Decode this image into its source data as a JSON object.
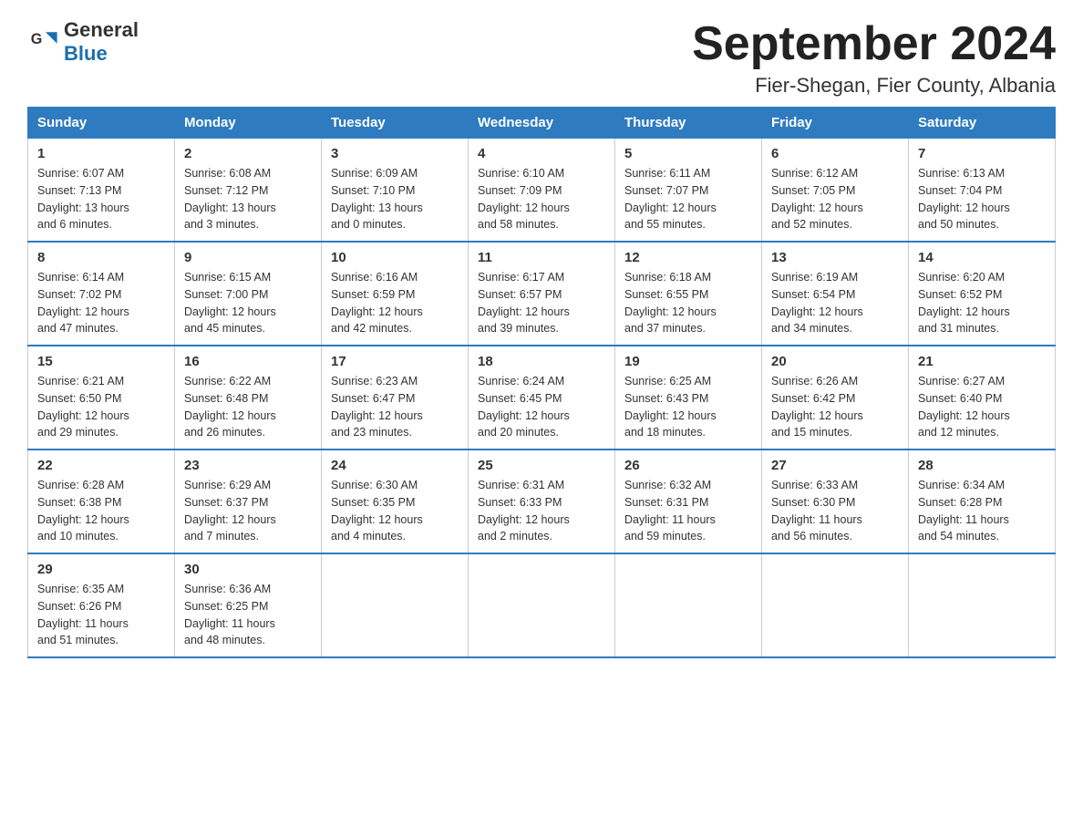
{
  "header": {
    "logo_general": "General",
    "logo_blue": "Blue",
    "month_title": "September 2024",
    "location": "Fier-Shegan, Fier County, Albania"
  },
  "weekdays": [
    "Sunday",
    "Monday",
    "Tuesday",
    "Wednesday",
    "Thursday",
    "Friday",
    "Saturday"
  ],
  "weeks": [
    [
      {
        "day": "1",
        "sunrise": "6:07 AM",
        "sunset": "7:13 PM",
        "daylight": "13 hours and 6 minutes."
      },
      {
        "day": "2",
        "sunrise": "6:08 AM",
        "sunset": "7:12 PM",
        "daylight": "13 hours and 3 minutes."
      },
      {
        "day": "3",
        "sunrise": "6:09 AM",
        "sunset": "7:10 PM",
        "daylight": "13 hours and 0 minutes."
      },
      {
        "day": "4",
        "sunrise": "6:10 AM",
        "sunset": "7:09 PM",
        "daylight": "12 hours and 58 minutes."
      },
      {
        "day": "5",
        "sunrise": "6:11 AM",
        "sunset": "7:07 PM",
        "daylight": "12 hours and 55 minutes."
      },
      {
        "day": "6",
        "sunrise": "6:12 AM",
        "sunset": "7:05 PM",
        "daylight": "12 hours and 52 minutes."
      },
      {
        "day": "7",
        "sunrise": "6:13 AM",
        "sunset": "7:04 PM",
        "daylight": "12 hours and 50 minutes."
      }
    ],
    [
      {
        "day": "8",
        "sunrise": "6:14 AM",
        "sunset": "7:02 PM",
        "daylight": "12 hours and 47 minutes."
      },
      {
        "day": "9",
        "sunrise": "6:15 AM",
        "sunset": "7:00 PM",
        "daylight": "12 hours and 45 minutes."
      },
      {
        "day": "10",
        "sunrise": "6:16 AM",
        "sunset": "6:59 PM",
        "daylight": "12 hours and 42 minutes."
      },
      {
        "day": "11",
        "sunrise": "6:17 AM",
        "sunset": "6:57 PM",
        "daylight": "12 hours and 39 minutes."
      },
      {
        "day": "12",
        "sunrise": "6:18 AM",
        "sunset": "6:55 PM",
        "daylight": "12 hours and 37 minutes."
      },
      {
        "day": "13",
        "sunrise": "6:19 AM",
        "sunset": "6:54 PM",
        "daylight": "12 hours and 34 minutes."
      },
      {
        "day": "14",
        "sunrise": "6:20 AM",
        "sunset": "6:52 PM",
        "daylight": "12 hours and 31 minutes."
      }
    ],
    [
      {
        "day": "15",
        "sunrise": "6:21 AM",
        "sunset": "6:50 PM",
        "daylight": "12 hours and 29 minutes."
      },
      {
        "day": "16",
        "sunrise": "6:22 AM",
        "sunset": "6:48 PM",
        "daylight": "12 hours and 26 minutes."
      },
      {
        "day": "17",
        "sunrise": "6:23 AM",
        "sunset": "6:47 PM",
        "daylight": "12 hours and 23 minutes."
      },
      {
        "day": "18",
        "sunrise": "6:24 AM",
        "sunset": "6:45 PM",
        "daylight": "12 hours and 20 minutes."
      },
      {
        "day": "19",
        "sunrise": "6:25 AM",
        "sunset": "6:43 PM",
        "daylight": "12 hours and 18 minutes."
      },
      {
        "day": "20",
        "sunrise": "6:26 AM",
        "sunset": "6:42 PM",
        "daylight": "12 hours and 15 minutes."
      },
      {
        "day": "21",
        "sunrise": "6:27 AM",
        "sunset": "6:40 PM",
        "daylight": "12 hours and 12 minutes."
      }
    ],
    [
      {
        "day": "22",
        "sunrise": "6:28 AM",
        "sunset": "6:38 PM",
        "daylight": "12 hours and 10 minutes."
      },
      {
        "day": "23",
        "sunrise": "6:29 AM",
        "sunset": "6:37 PM",
        "daylight": "12 hours and 7 minutes."
      },
      {
        "day": "24",
        "sunrise": "6:30 AM",
        "sunset": "6:35 PM",
        "daylight": "12 hours and 4 minutes."
      },
      {
        "day": "25",
        "sunrise": "6:31 AM",
        "sunset": "6:33 PM",
        "daylight": "12 hours and 2 minutes."
      },
      {
        "day": "26",
        "sunrise": "6:32 AM",
        "sunset": "6:31 PM",
        "daylight": "11 hours and 59 minutes."
      },
      {
        "day": "27",
        "sunrise": "6:33 AM",
        "sunset": "6:30 PM",
        "daylight": "11 hours and 56 minutes."
      },
      {
        "day": "28",
        "sunrise": "6:34 AM",
        "sunset": "6:28 PM",
        "daylight": "11 hours and 54 minutes."
      }
    ],
    [
      {
        "day": "29",
        "sunrise": "6:35 AM",
        "sunset": "6:26 PM",
        "daylight": "11 hours and 51 minutes."
      },
      {
        "day": "30",
        "sunrise": "6:36 AM",
        "sunset": "6:25 PM",
        "daylight": "11 hours and 48 minutes."
      },
      null,
      null,
      null,
      null,
      null
    ]
  ],
  "labels": {
    "sunrise": "Sunrise:",
    "sunset": "Sunset:",
    "daylight": "Daylight:"
  }
}
